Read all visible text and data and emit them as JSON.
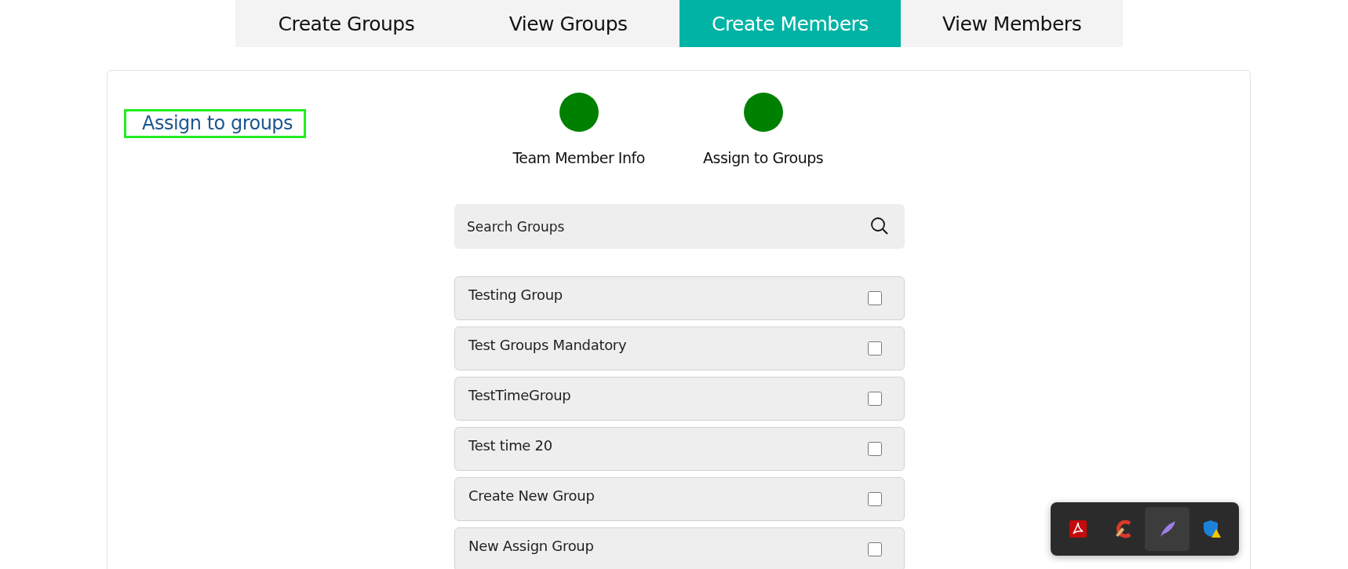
{
  "tabs": [
    {
      "label": "Create Groups",
      "selected": false
    },
    {
      "label": "View Groups",
      "selected": false
    },
    {
      "label": "Create Members",
      "selected": true
    },
    {
      "label": "View Members",
      "selected": false
    }
  ],
  "heading": {
    "text": "Assign to groups",
    "highlighted": true
  },
  "steps": [
    {
      "label": "Team Member Info",
      "completed": true
    },
    {
      "label": "Assign to Groups",
      "completed": true
    }
  ],
  "search": {
    "placeholder": "Search Groups"
  },
  "groups": [
    {
      "name": "Testing Group",
      "checked": false
    },
    {
      "name": "Test Groups Mandatory",
      "checked": false
    },
    {
      "name": "TestTimeGroup",
      "checked": false
    },
    {
      "name": "Test time 20",
      "checked": false
    },
    {
      "name": "Create New Group",
      "checked": false
    },
    {
      "name": "New Assign Group",
      "checked": false
    }
  ],
  "tray_popup": {
    "items": [
      {
        "kind": "pdf",
        "selected": false
      },
      {
        "kind": "cleaner",
        "selected": false
      },
      {
        "kind": "feather",
        "selected": true
      },
      {
        "kind": "shield",
        "selected": false
      }
    ]
  }
}
